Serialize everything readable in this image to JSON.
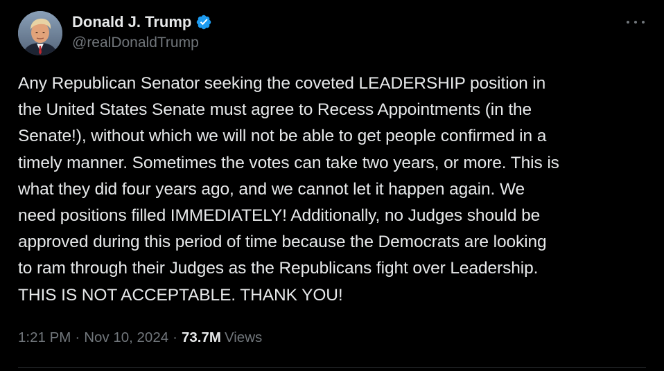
{
  "author": {
    "name": "Donald J. Trump",
    "handle": "@realDonaldTrump",
    "verified": true
  },
  "tweet": {
    "lines": [
      "Any Republican Senator seeking the coveted LEADERSHIP position in",
      "the United States Senate must agree to Recess Appointments (in the",
      "Senate!), without which we will not be able to get people confirmed in a",
      "timely manner. Sometimes the votes can take two years, or more. This is",
      "what they did four years ago, and we cannot let it happen again. We",
      "need positions filled IMMEDIATELY! Additionally, no Judges should be",
      "approved during this period of time because the Democrats are looking",
      "to ram through their Judges as the Republicans fight over Leadership.",
      "THIS IS NOT ACCEPTABLE. THANK YOU!"
    ]
  },
  "meta": {
    "time": "1:21 PM",
    "separator": "·",
    "date": "Nov 10, 2024",
    "views_count": "73.7M",
    "views_label": "Views"
  },
  "icons": {
    "verified": "verified-badge-icon",
    "more": "more-options-icon"
  },
  "colors": {
    "background": "#000000",
    "text": "#e7e9ea",
    "secondary": "#71767b",
    "verified": "#1d9bf0",
    "divider": "#2f3336"
  }
}
